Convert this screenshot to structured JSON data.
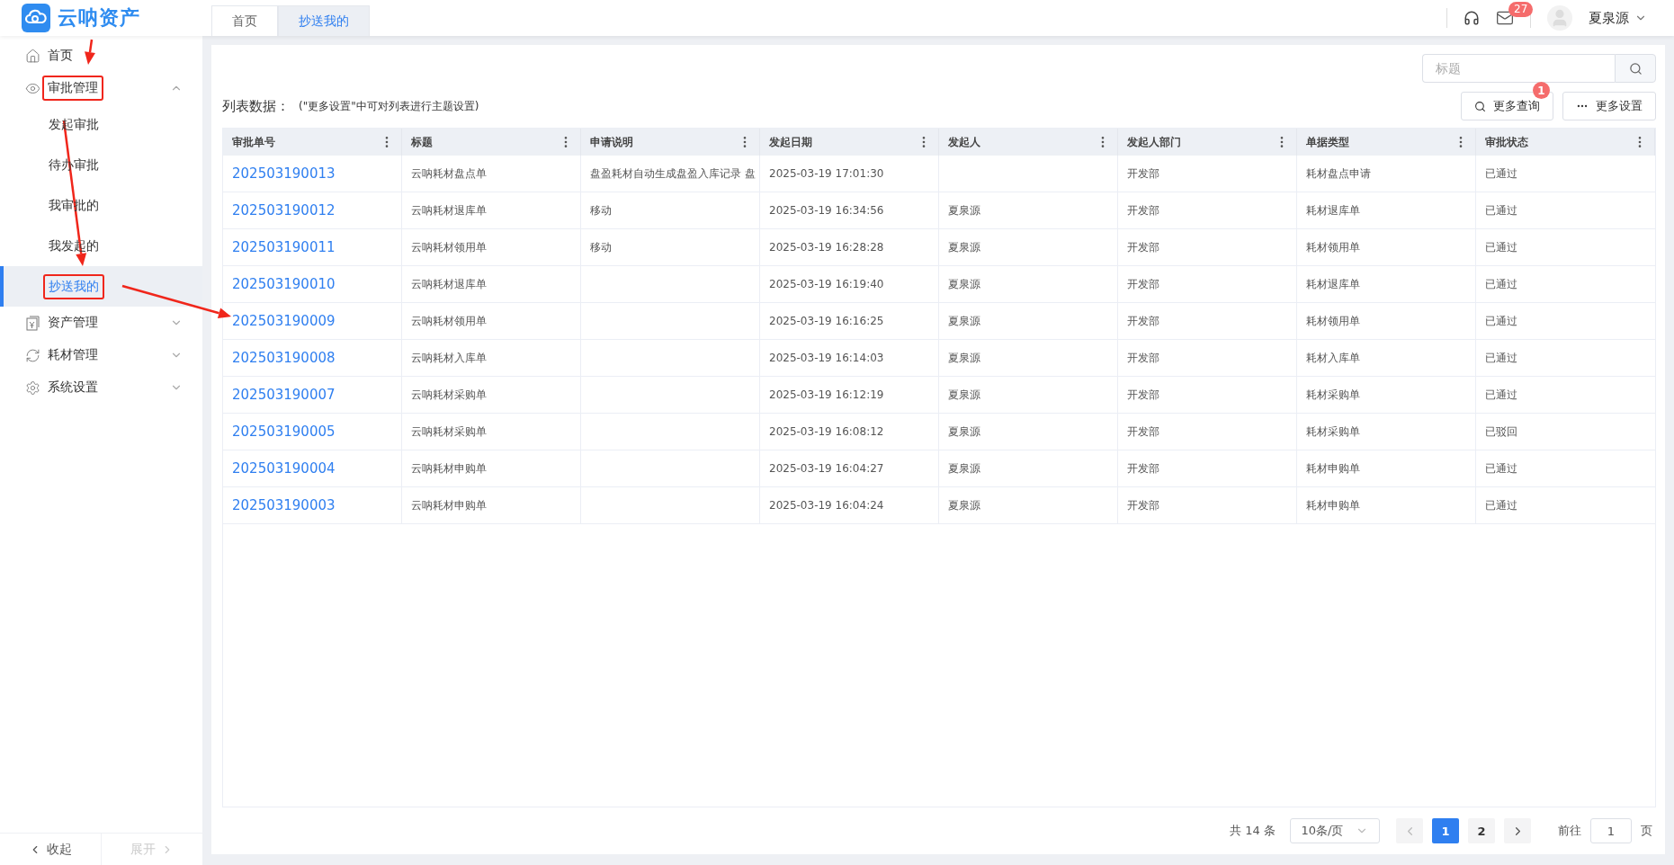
{
  "app": {
    "name": "云呐资产"
  },
  "tabs": [
    {
      "label": "首页",
      "selected": false
    },
    {
      "label": "抄送我的",
      "selected": true
    }
  ],
  "header": {
    "mail_count": "27",
    "user": "夏泉源"
  },
  "sidebar": {
    "items": [
      {
        "label": "首页",
        "annotated": false
      },
      {
        "label": "审批管理",
        "expanded": true,
        "annotated": true,
        "children": [
          {
            "label": "发起审批",
            "selected": false,
            "annotated": false
          },
          {
            "label": "待办审批",
            "selected": false,
            "annotated": false
          },
          {
            "label": "我审批的",
            "selected": false,
            "annotated": false
          },
          {
            "label": "我发起的",
            "selected": false,
            "annotated": false
          },
          {
            "label": "抄送我的",
            "selected": true,
            "annotated": true
          }
        ]
      },
      {
        "label": "资产管理",
        "expanded": false,
        "annotated": false
      },
      {
        "label": "耗材管理",
        "expanded": false,
        "annotated": false
      },
      {
        "label": "系统设置",
        "expanded": false,
        "annotated": false
      }
    ],
    "footer": [
      {
        "label": "收起",
        "disabled": false
      },
      {
        "label": "展开",
        "disabled": true
      }
    ]
  },
  "search": {
    "placeholder": "标题"
  },
  "toolbar": {
    "title": "列表数据：",
    "hint": "(\"更多设置\"中可对列表进行主题设置)",
    "buttons": [
      {
        "label": "更多查询",
        "kind": "search",
        "badge": "1"
      },
      {
        "label": "更多设置",
        "kind": "more"
      }
    ]
  },
  "table": {
    "columns": [
      "审批单号",
      "标题",
      "申请说明",
      "发起日期",
      "发起人",
      "发起人部门",
      "单据类型",
      "审批状态"
    ],
    "rows": [
      {
        "id": "202503190013",
        "title": "云呐耗材盘点单",
        "description": "盘盈耗材自动生成盘盈入库记录 盘",
        "date": "2025-03-19 17:01:30",
        "department": "开发部",
        "type": "耗材盘点申请",
        "status": "已通过"
      },
      {
        "id": "202503190012",
        "title": "云呐耗材退库单",
        "description": "移动",
        "date": "2025-03-19 16:34:56",
        "initiator": "夏泉源",
        "department": "开发部",
        "type": "耗材退库单",
        "status": "已通过"
      },
      {
        "id": "202503190011",
        "title": "云呐耗材领用单",
        "description": "移动",
        "date": "2025-03-19 16:28:28",
        "initiator": "夏泉源",
        "department": "开发部",
        "type": "耗材领用单",
        "status": "已通过"
      },
      {
        "id": "202503190010",
        "title": "云呐耗材退库单",
        "date": "2025-03-19 16:19:40",
        "initiator": "夏泉源",
        "department": "开发部",
        "type": "耗材退库单",
        "status": "已通过"
      },
      {
        "id": "202503190009",
        "title": "云呐耗材领用单",
        "date": "2025-03-19 16:16:25",
        "initiator": "夏泉源",
        "department": "开发部",
        "type": "耗材领用单",
        "status": "已通过"
      },
      {
        "id": "202503190008",
        "title": "云呐耗材入库单",
        "date": "2025-03-19 16:14:03",
        "initiator": "夏泉源",
        "department": "开发部",
        "type": "耗材入库单",
        "status": "已通过"
      },
      {
        "id": "202503190007",
        "title": "云呐耗材采购单",
        "date": "2025-03-19 16:12:19",
        "initiator": "夏泉源",
        "department": "开发部",
        "type": "耗材采购单",
        "status": "已通过"
      },
      {
        "id": "202503190005",
        "title": "云呐耗材采购单",
        "date": "2025-03-19 16:08:12",
        "initiator": "夏泉源",
        "department": "开发部",
        "type": "耗材采购单",
        "status": "已驳回"
      },
      {
        "id": "202503190004",
        "title": "云呐耗材申购单",
        "date": "2025-03-19 16:04:27",
        "initiator": "夏泉源",
        "department": "开发部",
        "type": "耗材申购单",
        "status": "已通过"
      },
      {
        "id": "202503190003",
        "title": "云呐耗材申购单",
        "date": "2025-03-19 16:04:24",
        "initiator": "夏泉源",
        "department": "开发部",
        "type": "耗材申购单",
        "status": "已通过"
      }
    ]
  },
  "pagination": {
    "total": "共 14 条",
    "page_size": "10条/页",
    "pages": [
      {
        "label": "1",
        "selected": true
      },
      {
        "label": "2",
        "selected": false
      }
    ],
    "goto_label": "前往",
    "goto_value": "1",
    "goto_suffix": "页"
  },
  "annotations": [
    {
      "kind": "arrow"
    },
    {
      "kind": "arrow"
    },
    {
      "kind": "arrow"
    }
  ]
}
